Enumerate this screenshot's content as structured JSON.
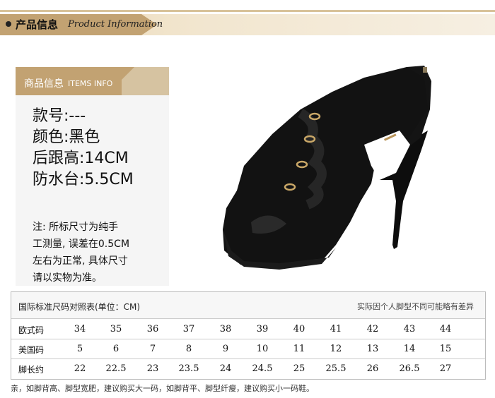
{
  "header": {
    "title_cn": "产品信息",
    "title_en": "Product Information"
  },
  "info": {
    "tab_cn": "商品信息",
    "tab_en": "ITEMS INFO",
    "specs": [
      "款号:---",
      "颜色:黑色",
      "后跟高:14CM",
      "防水台:5.5CM"
    ],
    "note_lines": [
      "注: 所标尺寸为纯手",
      "工测量, 误差在0.5CM",
      "左右为正常, 具体尺寸",
      "请以实物为准。"
    ]
  },
  "size_table": {
    "title": "国际标准尺码对照表(单位：CM)",
    "disclaimer": "实际因个人脚型不同可能略有差异",
    "rows": [
      {
        "label": "欧式码",
        "values": [
          "34",
          "35",
          "36",
          "37",
          "38",
          "39",
          "40",
          "41",
          "42",
          "43",
          "44"
        ]
      },
      {
        "label": "美国码",
        "values": [
          "5",
          "6",
          "7",
          "8",
          "9",
          "10",
          "11",
          "12",
          "13",
          "14",
          "15"
        ]
      },
      {
        "label": "脚长约",
        "values": [
          "22",
          "22.5",
          "23",
          "23.5",
          "24",
          "24.5",
          "25",
          "25.5",
          "26",
          "26.5",
          "27"
        ]
      }
    ]
  },
  "footnote": "亲，如脚背高、脚型宽肥，建议购买大一码，如脚背平、脚型纤瘦，建议购买小一码鞋。",
  "colors": {
    "accent_gold": "#c2a272",
    "shoe": "#111111"
  }
}
